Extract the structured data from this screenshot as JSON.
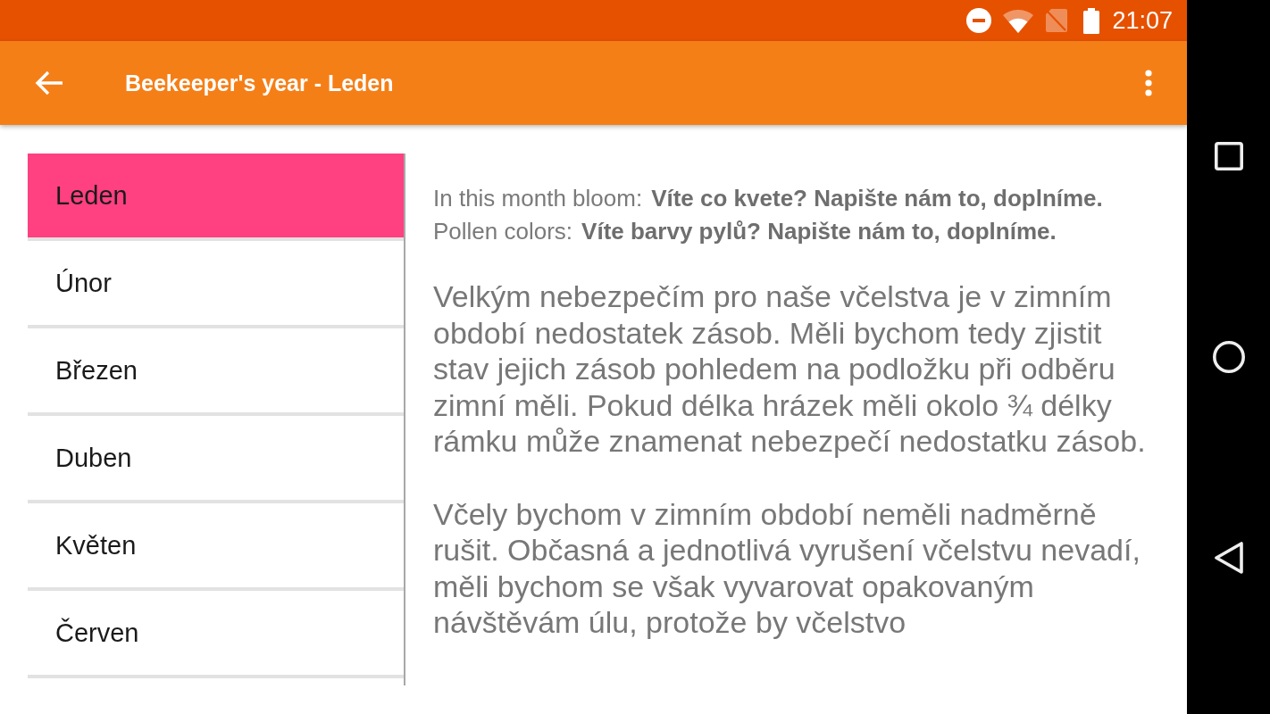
{
  "status_bar": {
    "time": "21:07"
  },
  "toolbar": {
    "title": "Beekeeper's year - Leden"
  },
  "months": [
    {
      "label": "Leden",
      "selected": true
    },
    {
      "label": "Únor",
      "selected": false
    },
    {
      "label": "Březen",
      "selected": false
    },
    {
      "label": "Duben",
      "selected": false
    },
    {
      "label": "Květen",
      "selected": false
    },
    {
      "label": "Červen",
      "selected": false
    }
  ],
  "info": [
    {
      "label": "In this month bloom:",
      "value": "Víte co kvete? Napište nám to, doplníme."
    },
    {
      "label": "Pollen colors:",
      "value": "Víte barvy pylů? Napište nám to, doplníme."
    }
  ],
  "paragraphs": [
    "Velkým nebezpečím pro naše včelstva je v zimním období nedostatek zásob. Měli bychom tedy zjistit stav jejich zásob pohledem na podložku při odběru zimní měli. Pokud délka hrázek měli okolo ¾ délky rámku může znamenat nebezpečí nedostatku zásob.",
    "Včely bychom v zimním období neměli nadměrně rušit. Občasná a jednotlivá vyrušení včelstvu nevadí, měli bychom se však vyvarovat opakovaným návštěvám úlu, protože by včelstvo"
  ]
}
